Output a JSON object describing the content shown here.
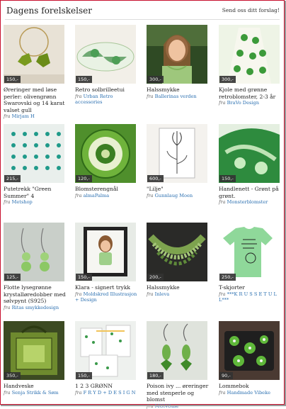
{
  "header": {
    "title": "Dagens forelskelser",
    "suggest_link": "Send oss ditt forslag!"
  },
  "from_label": "fra",
  "items": [
    {
      "price": "150,-",
      "name": "Øreringer med løse perler: olivengrønn Swarovski og 14 karat valset gull",
      "seller": "Mirjam H"
    },
    {
      "price": "150,-",
      "name": "Retro solbrilleetui",
      "seller": "Urban Retro accessories"
    },
    {
      "price": "300,-",
      "name": "Halssmykke",
      "seller": "Ballerinas verden"
    },
    {
      "price": "300,-",
      "name": "Kjole med grønne retroblomster, 2-3 år",
      "seller": "BraVo Design"
    },
    {
      "price": "215,-",
      "name": "Putetrekk \"Green Summer\" 4",
      "seller": "Metshop"
    },
    {
      "price": "120,-",
      "name": "Blomsterengnål",
      "seller": "almaPalma"
    },
    {
      "price": "600,-",
      "name": "\"Lilje\"",
      "seller": "Gunnlaug Moen"
    },
    {
      "price": "150,-",
      "name": "Handlenett - Grønt på grønt.",
      "seller": "Monsterblomster"
    },
    {
      "price": "125,-",
      "name": "Flotte lysegrønne krystalløredobber med sølvpynt (S925)",
      "seller": "Ritas smykkedesign"
    },
    {
      "price": "150,-",
      "name": "Klara - signert trykk",
      "seller": "Moldskred Illustrasjon + Design"
    },
    {
      "price": "200,-",
      "name": "Halssmykke",
      "seller": "Inleva"
    },
    {
      "price": "250,-",
      "name": "T-skjorter",
      "seller": "***K R U S S E T U L L***"
    },
    {
      "price": "350,-",
      "name": "Handveske",
      "seller": "Senja Strikk & Søm"
    },
    {
      "price": "150,-",
      "name": "1 2 3 GRØNN",
      "seller": "F R Y D + D E S I G N"
    },
    {
      "price": "180,-",
      "name": "Poison ivy ... øreringer med stenperle og blomst",
      "seller": "MONOme"
    },
    {
      "price": "90,-",
      "name": "Lommebok",
      "seller": "Handmade Vibeke"
    }
  ]
}
